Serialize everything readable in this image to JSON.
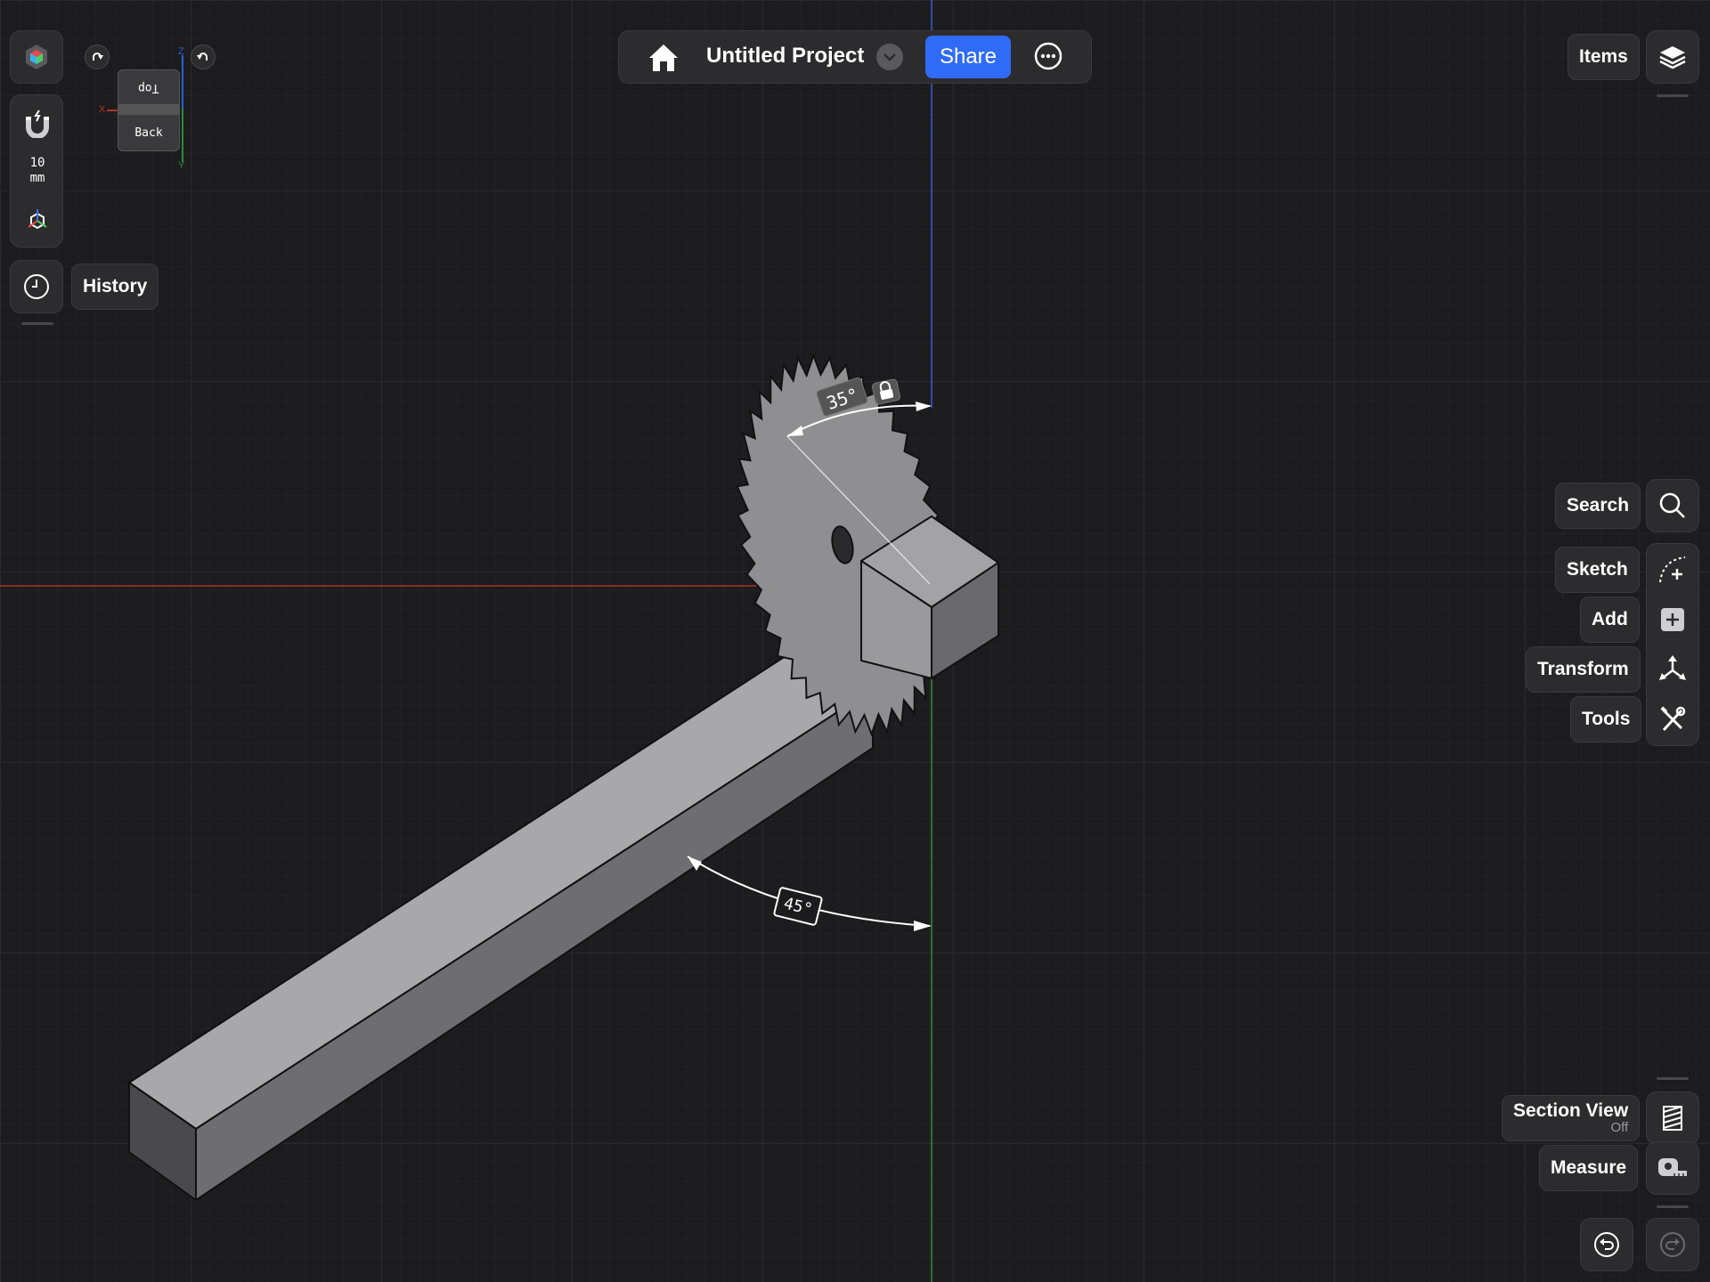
{
  "topbar": {
    "project_title": "Untitled Project",
    "share_label": "Share"
  },
  "left_toolbar": {
    "snap_value": "10",
    "snap_unit": "mm",
    "history_label": "History"
  },
  "view_cube": {
    "top_label": "Top",
    "back_label": "Back",
    "axis_x": "X",
    "axis_y": "Y",
    "axis_z": "Z"
  },
  "right_toolbar": {
    "items_label": "Items",
    "search_label": "Search",
    "sketch_label": "Sketch",
    "add_label": "Add",
    "transform_label": "Transform",
    "tools_label": "Tools",
    "section_view_label": "Section View",
    "section_view_state": "Off",
    "measure_label": "Measure"
  },
  "viewport": {
    "blade_angle_label": "35°",
    "beam_angle_label": "45°"
  },
  "colors": {
    "background": "#1c1c1e",
    "panel": "#2c2c2e",
    "accent": "#2f6bf6",
    "x_axis": "#c0392b",
    "y_axis": "#2e8b3a",
    "z_axis": "#2f5fd0"
  }
}
